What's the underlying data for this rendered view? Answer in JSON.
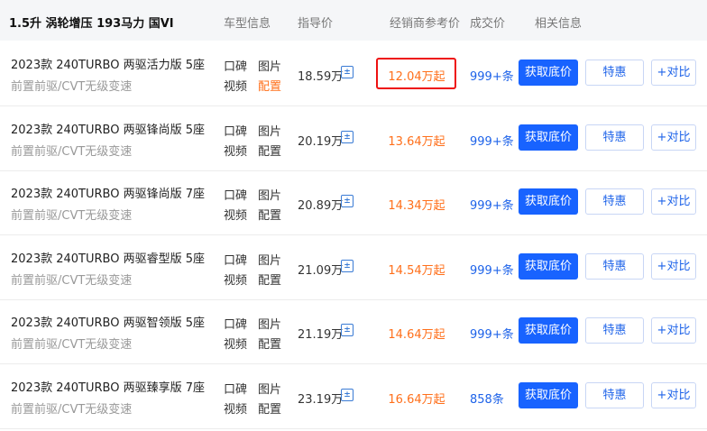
{
  "header": {
    "title": "1.5升 涡轮增压 193马力 国VI",
    "col_info": "车型信息",
    "col_msrp": "指导价",
    "col_dealer": "经销商参考价",
    "col_deal": "成交价",
    "col_related": "相关信息"
  },
  "labels": {
    "koubei": "口碑",
    "tupian": "图片",
    "shipin": "视频",
    "peizhi": "配置",
    "get_price": "获取底价",
    "special": "特惠",
    "compare": "+对比",
    "calc_glyph": "±"
  },
  "rows": [
    {
      "name": "2023款 240TURBO 两驱活力版 5座",
      "spec": "前置前驱/CVT无级变速",
      "msrp": "18.59万",
      "dealer": "12.04万起",
      "deals": "999+条"
    },
    {
      "name": "2023款 240TURBO 两驱锋尚版 5座",
      "spec": "前置前驱/CVT无级变速",
      "msrp": "20.19万",
      "dealer": "13.64万起",
      "deals": "999+条"
    },
    {
      "name": "2023款 240TURBO 两驱锋尚版 7座",
      "spec": "前置前驱/CVT无级变速",
      "msrp": "20.89万",
      "dealer": "14.34万起",
      "deals": "999+条"
    },
    {
      "name": "2023款 240TURBO 两驱睿型版 5座",
      "spec": "前置前驱/CVT无级变速",
      "msrp": "21.09万",
      "dealer": "14.54万起",
      "deals": "999+条"
    },
    {
      "name": "2023款 240TURBO 两驱智领版 5座",
      "spec": "前置前驱/CVT无级变速",
      "msrp": "21.19万",
      "dealer": "14.64万起",
      "deals": "999+条"
    },
    {
      "name": "2023款 240TURBO 两驱臻享版 7座",
      "spec": "前置前驱/CVT无级变速",
      "msrp": "23.19万",
      "dealer": "16.64万起",
      "deals": "858条"
    }
  ],
  "colors": {
    "accent_blue": "#1863ff",
    "price_orange": "#ff6f1a",
    "highlight_red": "#e11111"
  }
}
